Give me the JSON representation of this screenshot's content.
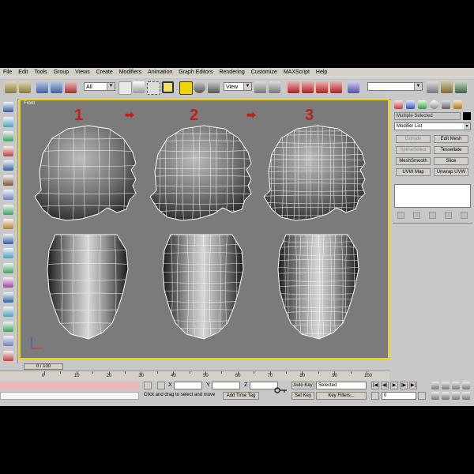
{
  "menubar": {
    "items": [
      "File",
      "Edit",
      "Tools",
      "Group",
      "Views",
      "Create",
      "Modifiers",
      "Animation",
      "Graph Editors",
      "Rendering",
      "Customize",
      "MAXScript",
      "Help"
    ]
  },
  "toolbar": {
    "filter_value": "All",
    "refcoord_value": "View"
  },
  "viewport": {
    "label": "Front",
    "steps": [
      "1",
      "2",
      "3"
    ],
    "arrow_glyph": "➡"
  },
  "command_panel": {
    "object_name": "Multiple Selected",
    "modifier_list": "Modifier List",
    "buttons": [
      {
        "label": "Extrude",
        "dim": true
      },
      {
        "label": "Edit Mesh",
        "dim": false
      },
      {
        "label": "SplineSelect",
        "dim": true
      },
      {
        "label": "Tessellate",
        "dim": false
      },
      {
        "label": "MeshSmooth",
        "dim": false
      },
      {
        "label": "Slice",
        "dim": false
      },
      {
        "label": "UVW Map",
        "dim": false
      },
      {
        "label": "Unwrap UVW",
        "dim": false
      }
    ]
  },
  "timeslider": {
    "label": "0 / 100"
  },
  "trackbar": {
    "ticks": [
      "0",
      "10",
      "20",
      "30",
      "40",
      "50",
      "60",
      "70",
      "80",
      "90",
      "100"
    ]
  },
  "statusbar": {
    "x_label": "X",
    "y_label": "Y",
    "z_label": "Z",
    "prompt": "Click and drag to select and move",
    "add_time_tag": "Add Time Tag",
    "auto_key": "Auto Key",
    "set_key": "Set Key",
    "key_filters": "Key Filters...",
    "selected_value": "Selected",
    "frame_value": "0"
  },
  "colors": {
    "viewport_bg": "#7b7b7b",
    "active_border": "#f0d400",
    "step_red": "#c02018"
  }
}
